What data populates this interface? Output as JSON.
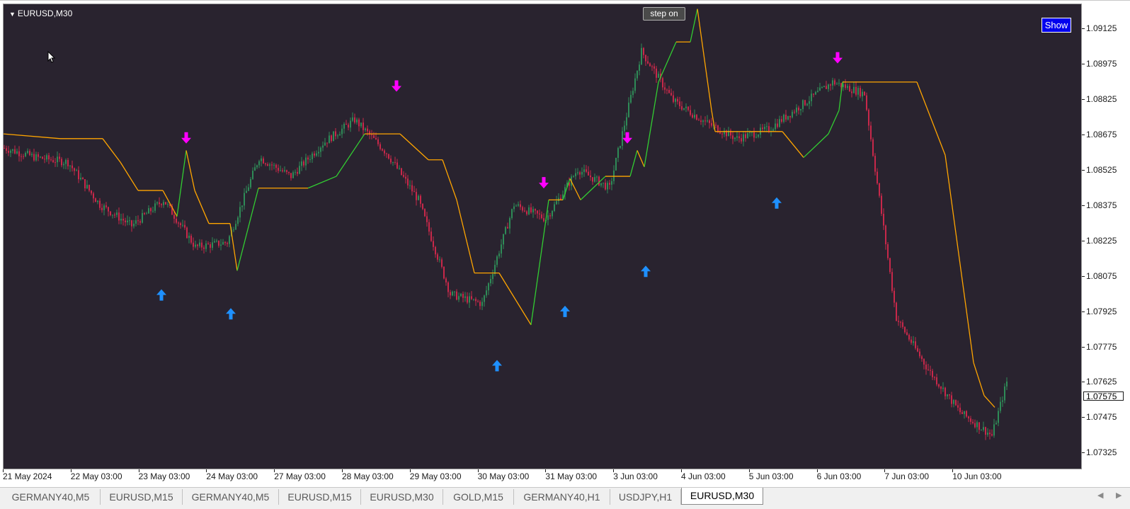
{
  "chart_window": {
    "symbol_title": "EURUSD,M30",
    "step_button_label": "step on",
    "show_button_label": "Show",
    "current_price": "1.07575"
  },
  "chart_data": {
    "type": "line",
    "price_axis_ticks": [
      "1.09125",
      "1.08975",
      "1.08825",
      "1.08675",
      "1.08525",
      "1.08375",
      "1.08225",
      "1.08075",
      "1.07925",
      "1.07775",
      "1.07625",
      "1.07475",
      "1.07325"
    ],
    "time_axis_ticks": [
      "21 May 2024",
      "22 May 03:00",
      "23 May 03:00",
      "24 May 03:00",
      "27 May 03:00",
      "28 May 03:00",
      "29 May 03:00",
      "30 May 03:00",
      "31 May 03:00",
      "3 Jun 03:00",
      "4 Jun 03:00",
      "5 Jun 03:00",
      "6 Jun 03:00",
      "7 Jun 03:00",
      "10 Jun 03:00"
    ],
    "ylim": [
      1.0726,
      1.0923
    ],
    "colors": {
      "background": "#29232f",
      "bull": "#2e8b57",
      "bear": "#c8284a",
      "trend_up": "#32cd32",
      "trend_down": "#ffa500",
      "sell_arrow": "#ff00ff",
      "buy_arrow": "#1e90ff"
    },
    "series": [
      {
        "role": "price",
        "x": [
          0,
          45,
          90,
          135,
          180,
          225,
          270,
          315,
          360,
          405,
          450,
          495,
          540,
          585,
          630,
          675,
          720,
          765,
          810,
          855,
          900,
          945,
          990,
          1035,
          1080,
          1125,
          1170,
          1215,
          1260,
          1305,
          1350,
          1395,
          1418
        ],
        "y": [
          1.0862,
          1.0858,
          1.0856,
          1.0838,
          1.0829,
          1.084,
          1.082,
          1.0822,
          1.0858,
          1.085,
          1.0864,
          1.0874,
          1.086,
          1.084,
          1.08,
          1.0796,
          1.0838,
          1.0832,
          1.0853,
          1.0845,
          1.0903,
          1.0882,
          1.0873,
          1.0866,
          1.087,
          1.088,
          1.089,
          1.0885,
          1.079,
          1.0768,
          1.075,
          1.074,
          1.0765
        ]
      },
      {
        "role": "trend",
        "x": [
          0,
          80,
          140,
          165,
          190,
          225,
          245,
          258,
          270,
          290,
          320,
          330,
          360,
          430,
          470,
          510,
          560,
          600,
          620,
          640,
          665,
          700,
          745,
          770,
          790,
          800,
          815,
          850,
          885,
          895,
          905,
          925,
          950,
          970,
          980,
          1000,
          1005,
          1100,
          1130,
          1165,
          1180,
          1185,
          1290,
          1330,
          1370,
          1385,
          1400
        ],
        "y": [
          1.0868,
          1.0866,
          1.0866,
          1.0856,
          1.0844,
          1.0844,
          1.0833,
          1.0861,
          1.0844,
          1.083,
          1.083,
          1.081,
          1.0845,
          1.0845,
          1.085,
          1.0868,
          1.0868,
          1.0857,
          1.0857,
          1.084,
          1.0809,
          1.0809,
          1.0787,
          1.084,
          1.084,
          1.0849,
          1.084,
          1.085,
          1.085,
          1.0861,
          1.0854,
          1.089,
          1.0907,
          1.0907,
          1.0921,
          1.0878,
          1.0869,
          1.0869,
          1.0858,
          1.0868,
          1.0878,
          1.089,
          1.089,
          1.0859,
          1.0771,
          1.0757,
          1.0752
        ]
      }
    ],
    "signals": {
      "sell_x": [
        258,
        555,
        881,
        763,
        1178
      ],
      "sell_y": [
        1.0866,
        1.0888,
        1.0866,
        1.0847,
        1.09
      ],
      "buy_x": [
        223,
        321,
        697,
        793,
        907,
        1092
      ],
      "buy_y": [
        1.08,
        1.0792,
        1.077,
        1.0793,
        1.081,
        1.0839
      ]
    }
  },
  "tabs": [
    {
      "label": "GERMANY40,M5"
    },
    {
      "label": "EURUSD,M15"
    },
    {
      "label": "GERMANY40,M5"
    },
    {
      "label": "EURUSD,M15"
    },
    {
      "label": "EURUSD,M30"
    },
    {
      "label": "GOLD,M15"
    },
    {
      "label": "GERMANY40,H1"
    },
    {
      "label": "USDJPY,H1"
    },
    {
      "label": "EURUSD,M30"
    }
  ],
  "tab_scroll": {
    "left_icon": "scroll-left-icon",
    "right_icon": "scroll-right-icon"
  }
}
